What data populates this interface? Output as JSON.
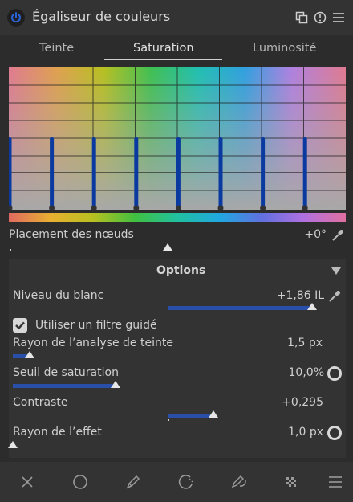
{
  "header": {
    "title": "Égaliseur de couleurs",
    "icons": [
      "power-icon",
      "duplicate-icon",
      "reset-icon",
      "menu-icon"
    ]
  },
  "tabs": [
    {
      "label": "Teinte",
      "active": false
    },
    {
      "label": "Saturation",
      "active": true
    },
    {
      "label": "Luminosité",
      "active": false
    }
  ],
  "graph": {
    "node_count": 8
  },
  "node_placement": {
    "label": "Placement des nœuds",
    "value": "+0°"
  },
  "options": {
    "title": "Options",
    "white_level": {
      "label": "Niveau du blanc",
      "value": "+1,86 IL",
      "fraction": 0.97
    },
    "guided_filter": {
      "label": "Utiliser un filtre guidé",
      "checked": true
    },
    "hue_radius": {
      "label": "Rayon de l’analyse de teinte",
      "value": "1,5 px",
      "fraction": 0.05
    },
    "saturation_threshold": {
      "label": "Seuil de saturation",
      "value": "10,0%",
      "fraction": 0.3
    },
    "contrast": {
      "label": "Contraste",
      "value": "+0,295",
      "fraction": 0.6
    },
    "effect_radius": {
      "label": "Rayon de l’effet",
      "value": "1,0 px",
      "fraction": 0.0
    }
  },
  "footer": {
    "icons": [
      "cancel-icon",
      "circle-mask-icon",
      "pencil-icon",
      "parametric-mask-icon",
      "drawn-parametric-mask-icon",
      "raster-mask-icon",
      "blend-menu-icon"
    ]
  },
  "colors": {
    "accent": "#2a4fa8",
    "node_blue": "#0a3aa0",
    "background": "#2c2c2c"
  }
}
